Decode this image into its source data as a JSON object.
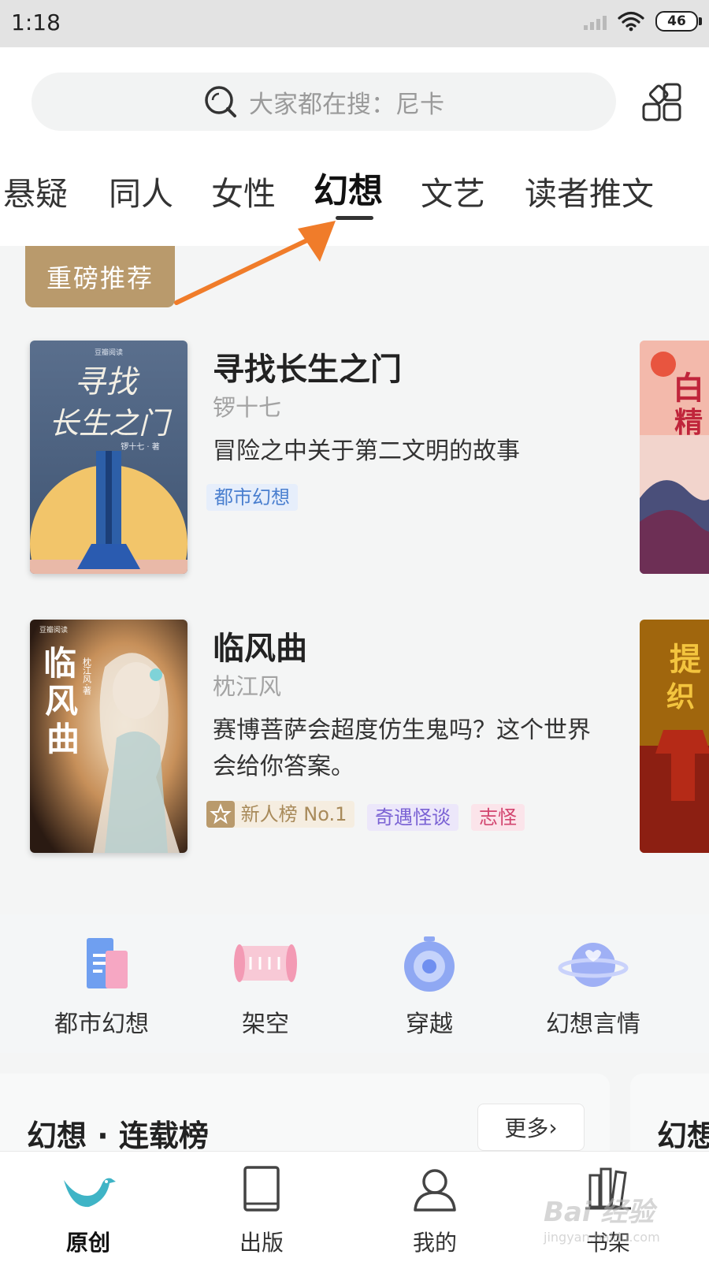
{
  "status_bar": {
    "time": "1:18",
    "battery": "46"
  },
  "search": {
    "placeholder": "大家都在搜：尼卡"
  },
  "tabs": [
    {
      "label": "悬疑"
    },
    {
      "label": "同人"
    },
    {
      "label": "女性"
    },
    {
      "label": "幻想",
      "active": true
    },
    {
      "label": "文艺"
    },
    {
      "label": "读者推文"
    }
  ],
  "section_badge": "重磅推荐",
  "books": [
    {
      "title": "寻找长生之门",
      "author": "锣十七",
      "description": "冒险之中关于第二文明的故事",
      "tags": [
        {
          "text": "都市幻想",
          "color": "#4a7fcf",
          "bg": "#e6eefb"
        }
      ],
      "cover": {
        "title_lines": [
          "寻找",
          "长生之门"
        ],
        "byline": "锣十七 · 著",
        "publisher": "豆瓣阅读"
      }
    },
    {
      "title": "临风曲",
      "author": "枕江风",
      "description": "赛博菩萨会超度仿生鬼吗？这个世界会给你答案。",
      "tags": [
        {
          "text": "新人榜 No.1",
          "color": "#a88a5a",
          "bg": "#f5ede0",
          "icon": "star-icon"
        },
        {
          "text": "奇遇怪谈",
          "color": "#7a62d4",
          "bg": "#ece7fa"
        },
        {
          "text": "志怪",
          "color": "#d2456f",
          "bg": "#fbe4ea"
        }
      ],
      "cover": {
        "title_lines": [
          "临",
          "风",
          "曲"
        ],
        "byline": "枕江风·著",
        "publisher": "豆瓣阅读"
      }
    }
  ],
  "peek_covers": [
    {
      "chars": "白\n精"
    },
    {
      "chars": "提\n织"
    }
  ],
  "categories": [
    {
      "label": "都市幻想",
      "icon": "book-stack-icon"
    },
    {
      "label": "架空",
      "icon": "scroll-icon"
    },
    {
      "label": "穿越",
      "icon": "portal-icon"
    },
    {
      "label": "幻想言情",
      "icon": "planet-icon"
    }
  ],
  "ranking": {
    "title": "幻想 · 连载榜",
    "more": "更多",
    "peek_title": "幻想"
  },
  "bottom_nav": [
    {
      "label": "原创",
      "icon": "bird-icon",
      "active": true
    },
    {
      "label": "出版",
      "icon": "book-icon"
    },
    {
      "label": "我的",
      "icon": "user-icon"
    },
    {
      "label": "书架",
      "icon": "bookshelf-icon"
    }
  ],
  "watermark": {
    "text": "Bai 经验",
    "sub": "jingyan.baidu.com"
  },
  "colors": {
    "accent_gold": "#b99a6c",
    "arrow": "#f07c2a",
    "brand_teal": "#3fb4c6"
  }
}
